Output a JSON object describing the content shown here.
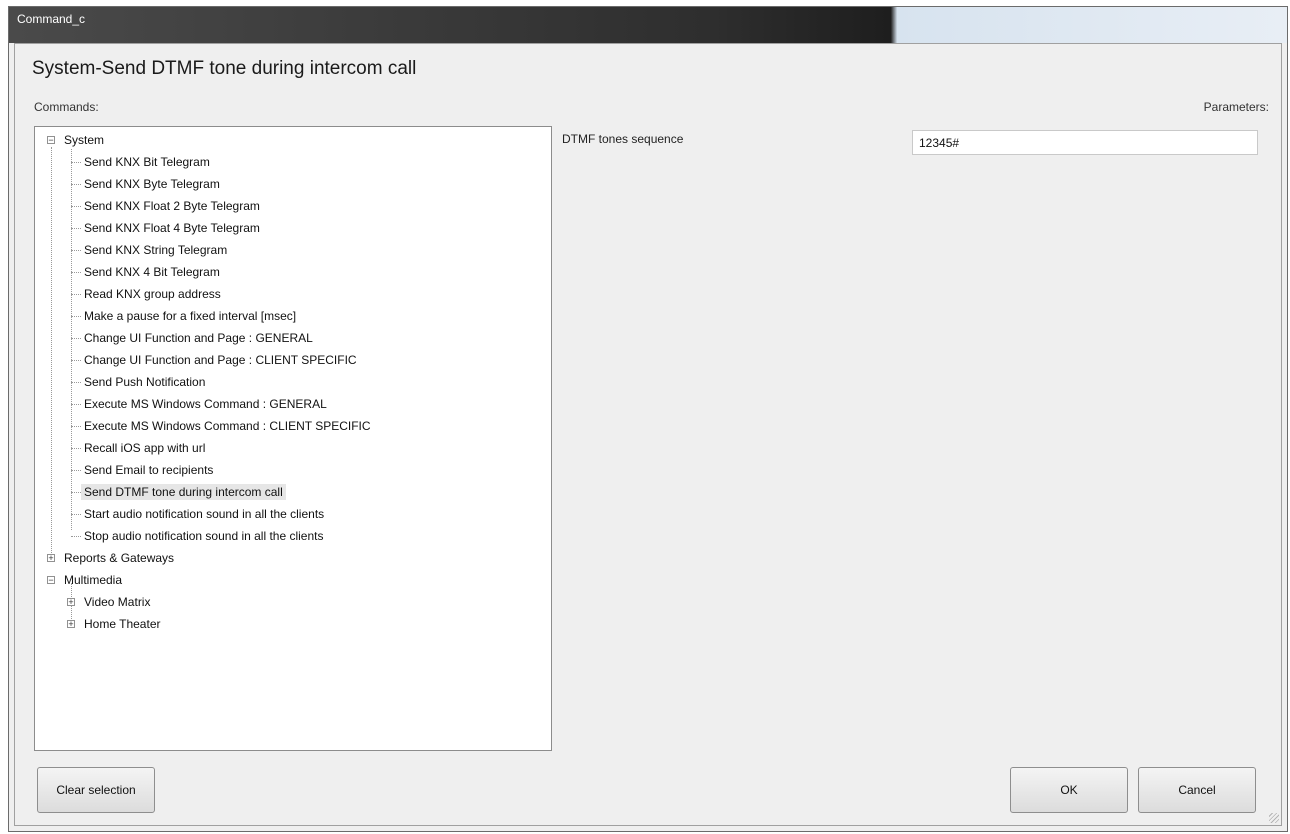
{
  "window": {
    "title": "Command_c"
  },
  "header": {
    "title": "System-Send DTMF tone during intercom call"
  },
  "labels": {
    "commands": "Commands:",
    "parameters": "Parameters:"
  },
  "tree": {
    "system": "System",
    "system_children": [
      "Send KNX Bit Telegram",
      "Send KNX Byte Telegram",
      "Send KNX Float 2 Byte Telegram",
      "Send KNX Float 4 Byte Telegram",
      "Send KNX String Telegram",
      "Send KNX 4 Bit Telegram",
      "Read KNX group address",
      "Make a pause for a fixed interval [msec]",
      "Change UI Function and Page : GENERAL",
      "Change UI Function and Page : CLIENT SPECIFIC",
      "Send Push Notification",
      "Execute MS Windows Command : GENERAL",
      "Execute MS Windows Command : CLIENT SPECIFIC",
      "Recall iOS app with url",
      "Send Email to recipients",
      "Send DTMF tone during intercom call",
      "Start audio notification sound in all the clients",
      "Stop audio notification sound in all the clients"
    ],
    "reports": "Reports & Gateways",
    "multimedia": "Multimedia",
    "multimedia_children": [
      "Video Matrix",
      "Home Theater"
    ]
  },
  "parameter": {
    "label": "DTMF tones sequence",
    "value": "12345#"
  },
  "buttons": {
    "clear": "Clear selection",
    "ok": "OK",
    "cancel": "Cancel"
  }
}
